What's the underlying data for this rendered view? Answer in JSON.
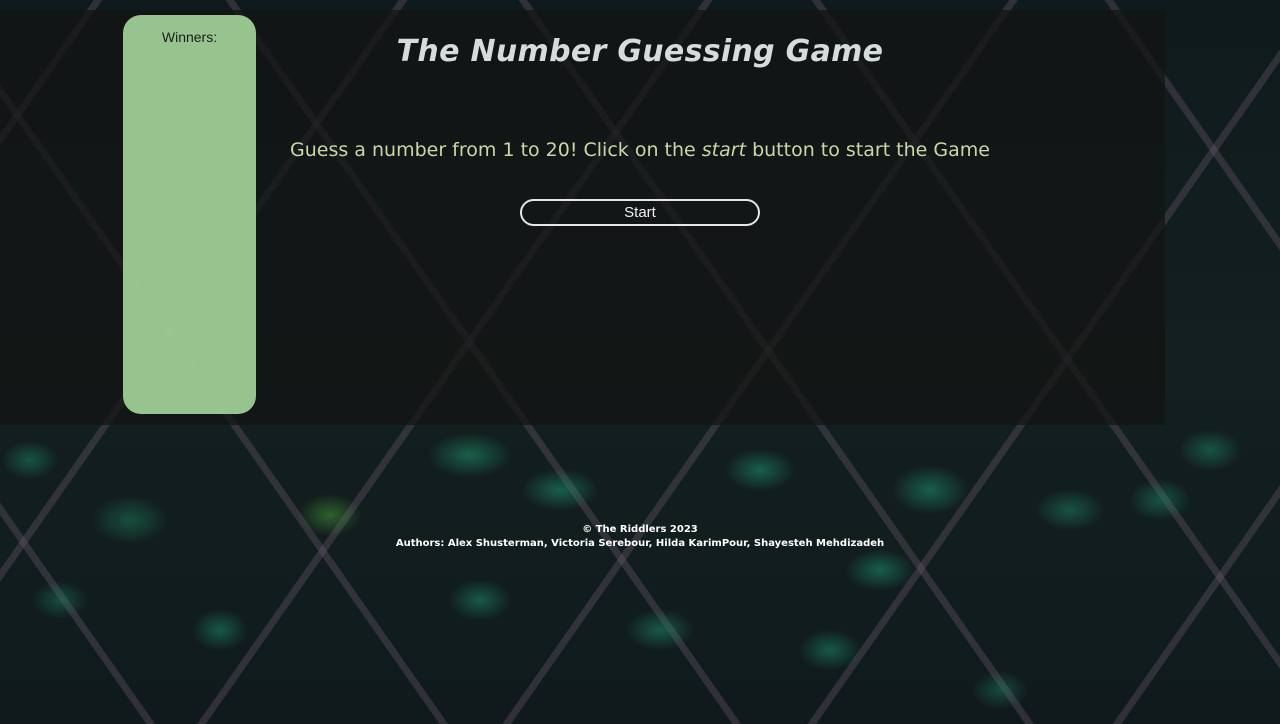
{
  "winners": {
    "title": "Winners:"
  },
  "game": {
    "title": "The Number Guessing Game",
    "instruction_before": "Guess a number from 1 to 20! Click on the ",
    "instruction_emphasis": "start",
    "instruction_after": " button to start the Game",
    "start_label": "Start"
  },
  "footer": {
    "copyright": "© The Riddlers 2023",
    "authors": "Authors: Alex Shusterman, Victoria Serebour, Hilda KarimPour, Shayesteh Mehdizadeh"
  },
  "colors": {
    "winners_panel": "#aadca0",
    "title_text": "#d4dcdc",
    "instruction_text": "#c9d8a6",
    "button_border": "#e6e6e6"
  }
}
